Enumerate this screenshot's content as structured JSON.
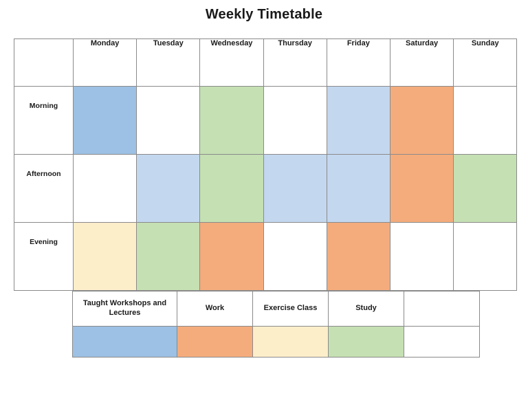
{
  "page": {
    "title": "Weekly Timetable"
  },
  "timetable": {
    "corner_label": "",
    "day_headers": [
      "Monday",
      "Tuesday",
      "Wednesday",
      "Thursday",
      "Friday",
      "Saturday",
      "Sunday"
    ],
    "row_labels": [
      "Morning",
      "Afternoon",
      "Evening"
    ],
    "rows": [
      {
        "label": "Morning",
        "cells": [
          {
            "day": "Monday",
            "color": "#9cc1e4",
            "category": "Taught Workshops and Lectures",
            "text": ""
          },
          {
            "day": "Tuesday",
            "color": "#ffffff",
            "category": "",
            "text": ""
          },
          {
            "day": "Wednesday",
            "color": "#c5e0b3",
            "category": "Study",
            "text": ""
          },
          {
            "day": "Thursday",
            "color": "#ffffff",
            "category": "",
            "text": ""
          },
          {
            "day": "Friday",
            "color": "#c3d7ef",
            "category": "Taught Workshops and Lectures",
            "text": ""
          },
          {
            "day": "Saturday",
            "color": "#f4ac7c",
            "category": "Work",
            "text": ""
          },
          {
            "day": "Sunday",
            "color": "#ffffff",
            "category": "",
            "text": ""
          }
        ]
      },
      {
        "label": "Afternoon",
        "cells": [
          {
            "day": "Monday",
            "color": "#ffffff",
            "category": "",
            "text": ""
          },
          {
            "day": "Tuesday",
            "color": "#c3d7ef",
            "category": "Taught Workshops and Lectures",
            "text": ""
          },
          {
            "day": "Wednesday",
            "color": "#c5e0b3",
            "category": "Study",
            "text": ""
          },
          {
            "day": "Thursday",
            "color": "#c3d7ef",
            "category": "Taught Workshops and Lectures",
            "text": ""
          },
          {
            "day": "Friday",
            "color": "#c3d7ef",
            "category": "Taught Workshops and Lectures",
            "text": ""
          },
          {
            "day": "Saturday",
            "color": "#f4ac7c",
            "category": "Work",
            "text": ""
          },
          {
            "day": "Sunday",
            "color": "#c5e0b3",
            "category": "Study",
            "text": ""
          }
        ]
      },
      {
        "label": "Evening",
        "cells": [
          {
            "day": "Monday",
            "color": "#fdeeca",
            "category": "Exercise Class",
            "text": ""
          },
          {
            "day": "Tuesday",
            "color": "#c5e0b3",
            "category": "Study",
            "text": ""
          },
          {
            "day": "Wednesday",
            "color": "#f4ac7c",
            "category": "Work",
            "text": ""
          },
          {
            "day": "Thursday",
            "color": "#ffffff",
            "category": "",
            "text": ""
          },
          {
            "day": "Friday",
            "color": "#f4ac7c",
            "category": "Work",
            "text": ""
          },
          {
            "day": "Saturday",
            "color": "#ffffff",
            "category": "",
            "text": ""
          },
          {
            "day": "Sunday",
            "color": "#ffffff",
            "category": "",
            "text": ""
          }
        ]
      }
    ]
  },
  "legend": {
    "entries": [
      {
        "label": "Taught Workshops and Lectures",
        "color": "#9cc1e4"
      },
      {
        "label": "Work",
        "color": "#f4ac7c"
      },
      {
        "label": "Exercise Class",
        "color": "#fdeeca"
      },
      {
        "label": "Study",
        "color": "#c5e0b3"
      },
      {
        "label": "",
        "color": "#ffffff"
      }
    ]
  },
  "colors": {
    "blue": "#9cc1e4",
    "light_blue": "#c3d7ef",
    "orange": "#f4ac7c",
    "green": "#c5e0b3",
    "cream": "#fdeeca",
    "white": "#ffffff",
    "border": "#8a8a8a",
    "text": "#1a1a1a"
  }
}
